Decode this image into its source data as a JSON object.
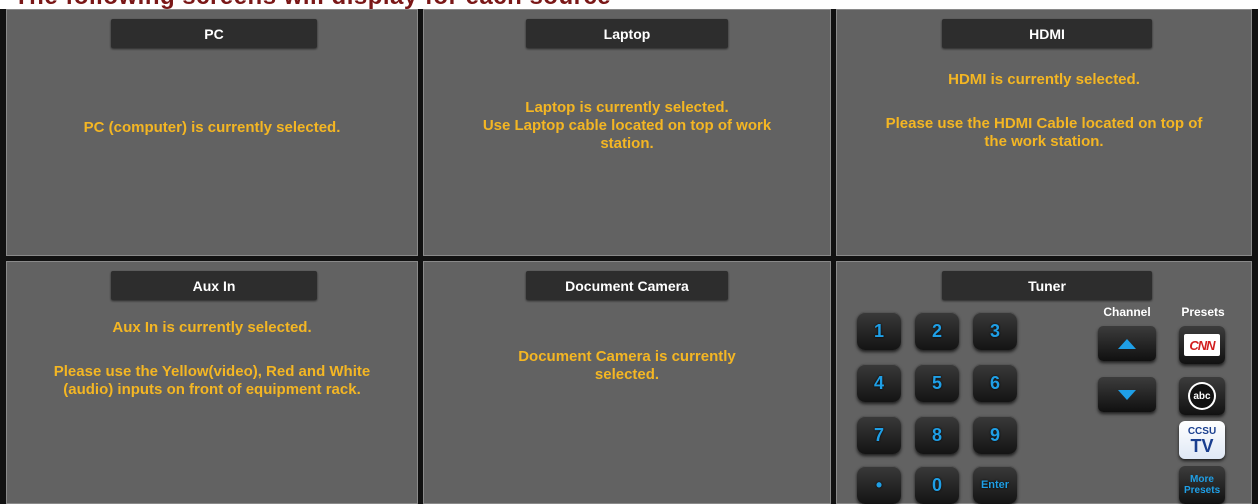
{
  "header": {
    "title": "The following screens will display for each source"
  },
  "panels": {
    "pc": {
      "label": "PC",
      "lines": [
        "PC (computer) is currently selected."
      ]
    },
    "laptop": {
      "label": "Laptop",
      "lines": [
        "Laptop is currently selected.",
        "Use Laptop cable located on top of work",
        "station."
      ]
    },
    "hdmi": {
      "label": "HDMI",
      "lines": [
        "HDMI is currently selected.",
        "",
        "Please use the HDMI Cable located on top of",
        "the work station."
      ]
    },
    "aux": {
      "label": "Aux In",
      "lines": [
        "Aux In is currently selected.",
        "",
        "Please use the Yellow(video), Red and White",
        "(audio) inputs on front of equipment rack."
      ]
    },
    "doccam": {
      "label": "Document Camera",
      "lines": [
        "Document Camera is currently",
        "selected."
      ]
    },
    "tuner": {
      "label": "Tuner",
      "keys": [
        "1",
        "2",
        "3",
        "4",
        "5",
        "6",
        "7",
        "8",
        "9",
        "•",
        "0",
        "Enter"
      ],
      "channel_label": "Channel",
      "presets_label": "Presets",
      "presets": {
        "cnn": "CNN",
        "abc": "abc",
        "ccsu_top": "CCSU",
        "ccsu_bottom": "TV",
        "more": "More Presets"
      }
    }
  },
  "colors": {
    "message": "#f4b623",
    "panel": "#626262",
    "key_text": "#1f9fe6",
    "header": "#7a1717"
  }
}
